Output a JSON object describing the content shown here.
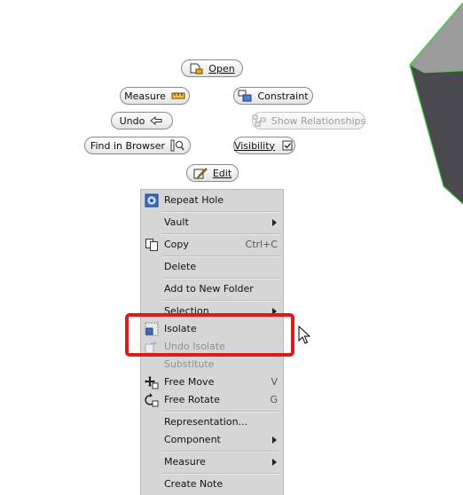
{
  "marking_menu": {
    "open": "Open",
    "measure": "Measure",
    "constraint": "Constraint",
    "undo": "Undo",
    "show_relationships": "Show Relationships",
    "find_in_browser": "Find in Browser",
    "visibility": "Visibility",
    "edit": "Edit"
  },
  "context_menu": {
    "items": [
      {
        "label": "Repeat Hole",
        "shortcut": "",
        "submenu": false,
        "icon": "repeat-hole-icon"
      },
      {
        "label": "Vault",
        "shortcut": "",
        "submenu": true
      },
      {
        "label": "Copy",
        "shortcut": "Ctrl+C",
        "submenu": false,
        "icon": "copy-icon"
      },
      {
        "label": "Delete",
        "shortcut": "",
        "submenu": false
      },
      {
        "label": "Add to New Folder",
        "shortcut": "",
        "submenu": false
      },
      {
        "label": "Selection",
        "shortcut": "",
        "submenu": true
      },
      {
        "label": "Isolate",
        "shortcut": "",
        "submenu": false,
        "icon": "isolate-icon"
      },
      {
        "label": "Undo Isolate",
        "shortcut": "",
        "submenu": false,
        "disabled": true,
        "icon": "undo-isolate-icon"
      },
      {
        "label": "Substitute",
        "shortcut": "",
        "submenu": false,
        "disabled": true
      },
      {
        "label": "Free Move",
        "shortcut": "V",
        "submenu": false,
        "icon": "free-move-icon"
      },
      {
        "label": "Free Rotate",
        "shortcut": "G",
        "submenu": false,
        "icon": "free-rotate-icon"
      },
      {
        "label": "Representation...",
        "shortcut": "",
        "submenu": false
      },
      {
        "label": "Component",
        "shortcut": "",
        "submenu": true
      },
      {
        "label": "Measure",
        "shortcut": "",
        "submenu": true
      },
      {
        "label": "Create Note",
        "shortcut": "",
        "submenu": false
      }
    ]
  },
  "colors": {
    "highlight": "#e01919",
    "menu_bg": "#d6d6d6",
    "part_face": "#4a4a4e",
    "part_top": "#9b9b9b",
    "part_edge": "#3cd23c"
  }
}
